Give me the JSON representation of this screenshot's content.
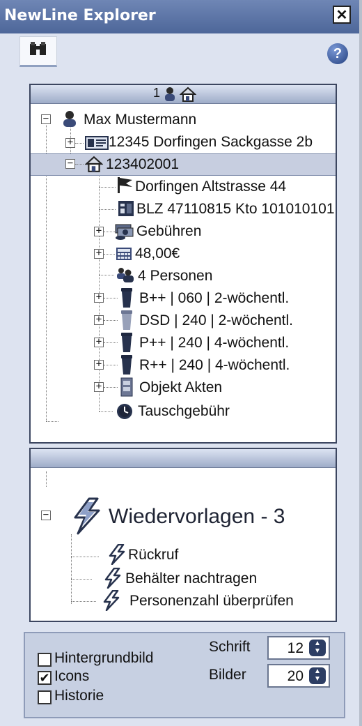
{
  "window": {
    "title": "NewLine Explorer",
    "close_label": "✕"
  },
  "toolbar": {
    "find_icon": "binoculars-icon",
    "help_label": "?"
  },
  "panel1": {
    "header_count": "1",
    "tree": {
      "root": {
        "label": "Max Mustermann",
        "expander": "−"
      },
      "address": {
        "label": "12345 Dorfingen Sackgasse 2b",
        "expander": "+"
      },
      "object": {
        "label": "123402001",
        "expander": "−"
      },
      "children": [
        {
          "label": "Dorfingen Altstrasse 44",
          "icon": "flag-icon",
          "expander": ""
        },
        {
          "label": "BLZ 47110815  Kto 101010101",
          "icon": "bank-card-icon",
          "expander": ""
        },
        {
          "label": "Gebühren",
          "icon": "money-icon",
          "expander": "+"
        },
        {
          "label": "48,00€",
          "icon": "calculator-icon",
          "expander": "+"
        },
        {
          "label": "4 Personen",
          "icon": "persons-icon",
          "expander": ""
        },
        {
          "label": "B++ | 060 | 2-wöchentl.",
          "icon": "bin-dark-icon",
          "expander": "+"
        },
        {
          "label": "DSD | 240 | 2-wöchentl.",
          "icon": "bin-gray-icon",
          "expander": "+"
        },
        {
          "label": "P++ | 240 | 4-wöchentl.",
          "icon": "bin-dark-icon",
          "expander": "+"
        },
        {
          "label": "R++ | 240 | 4-wöchentl.",
          "icon": "bin-dark-icon",
          "expander": "+"
        },
        {
          "label": "Objekt Akten",
          "icon": "file-cabinet-icon",
          "expander": "+"
        },
        {
          "label": "Tauschgebühr",
          "icon": "clock-icon",
          "expander": ""
        }
      ]
    }
  },
  "panel2": {
    "header": "",
    "root": {
      "label": "Wiedervorlagen - 3",
      "expander": "−"
    },
    "items": [
      {
        "label": "Rückruf"
      },
      {
        "label": "Behälter nachtragen"
      },
      {
        "label": "Personenzahl überprüfen"
      }
    ]
  },
  "options": {
    "hintergrundbild": {
      "label": "Hintergrundbild",
      "checked": false,
      "mark": ""
    },
    "icons": {
      "label": "Icons",
      "checked": true,
      "mark": "✔"
    },
    "historie": {
      "label": "Historie",
      "checked": false,
      "mark": ""
    },
    "schrift": {
      "label": "Schrift",
      "value": "12"
    },
    "bilder": {
      "label": "Bilder",
      "value": "20"
    },
    "spin_up": "▲",
    "spin_down": "▼"
  },
  "colors": {
    "titlebar": "#5a72a6",
    "selection": "#c7cee0",
    "panel_header": "#aebad3",
    "icon_dark": "#27324d"
  }
}
